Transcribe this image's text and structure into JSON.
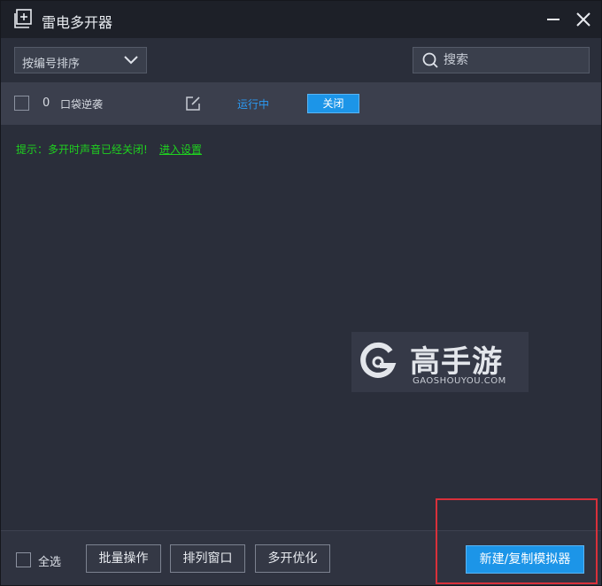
{
  "window": {
    "title": "雷电多开器"
  },
  "toolbar": {
    "sort_label": "按编号排序",
    "search_placeholder": "搜索"
  },
  "instances": [
    {
      "index": "0",
      "name": "口袋逆袭",
      "status": "运行中",
      "action_label": "关闭"
    }
  ],
  "notice": {
    "text": "提示：多开时声音已经关闭!",
    "link": "进入设置"
  },
  "watermark": {
    "name": "高手游",
    "domain": "GAOSHOUYOU.COM"
  },
  "footer": {
    "select_all": "全选",
    "batch": "批量操作",
    "arrange": "排列窗口",
    "optimize": "多开优化",
    "new_copy": "新建/复制模拟器"
  },
  "colors": {
    "accent": "#1c95e8",
    "notice_green": "#1fd11f",
    "status_blue": "#2b9af3",
    "highlight_red": "#d9303a"
  },
  "icons": {
    "app": "multi-window-add-icon",
    "minimize": "minimize-icon",
    "close": "close-icon",
    "dropdown": "chevron-down-icon",
    "search": "search-icon",
    "edit": "edit-icon"
  }
}
